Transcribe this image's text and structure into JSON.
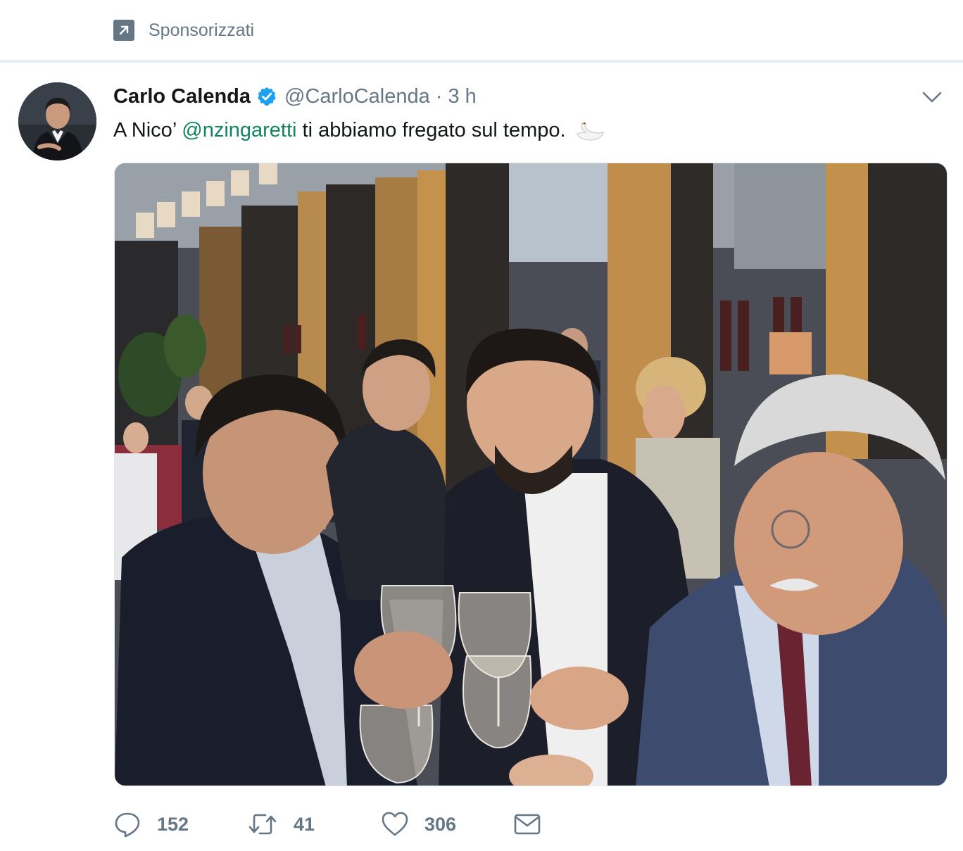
{
  "promoted": {
    "label": "Sponsorizzati",
    "icon": "promoted-arrow-icon"
  },
  "tweet": {
    "display_name": "Carlo Calenda",
    "verified": true,
    "handle": "@CarloCalenda",
    "separator": "·",
    "time": "3 h",
    "text_before": "A Nico’ ",
    "mention": "@nzingaretti",
    "text_after": " ti abbiamo fregato sul tempo.",
    "emoji_icon": "swan-icon",
    "media_icon": "photo",
    "actions": {
      "replies": "152",
      "retweets": "41",
      "likes": "306"
    }
  },
  "colors": {
    "link": "#11855b",
    "muted": "#657786",
    "verified": "#1da1f2",
    "background": "#e6ecf0"
  }
}
